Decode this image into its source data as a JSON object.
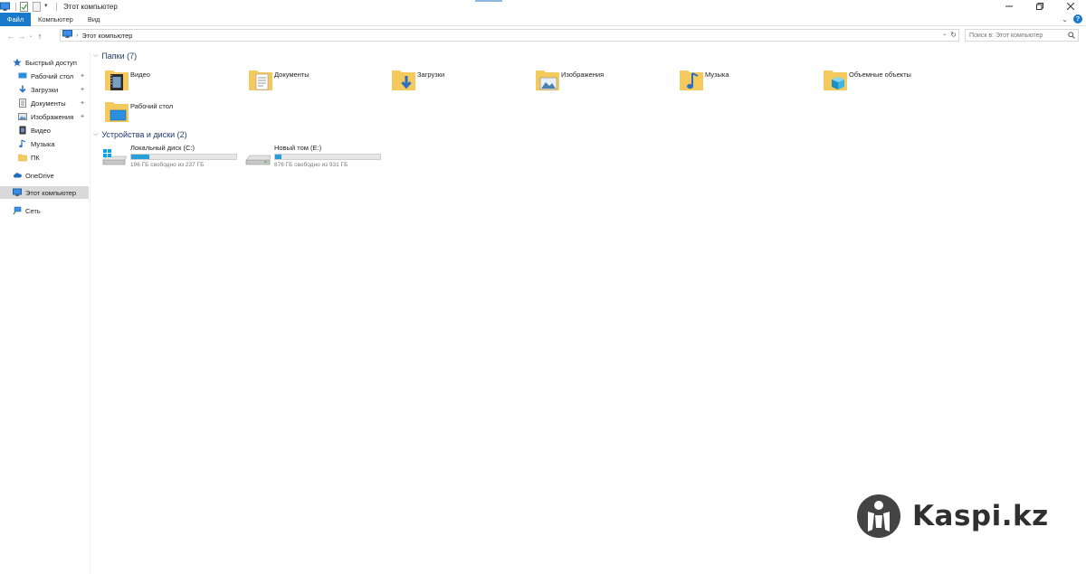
{
  "window": {
    "title": "Этот компьютер",
    "controls": [
      "minimize",
      "restore",
      "close"
    ]
  },
  "ribbon": {
    "tabs": [
      {
        "label": "Файл",
        "active": true
      },
      {
        "label": "Компьютер"
      },
      {
        "label": "Вид"
      }
    ]
  },
  "navigation": {
    "address": "Этот компьютер",
    "search_placeholder": "Поиск в: Этот компьютер"
  },
  "sidebar": {
    "items": [
      {
        "label": "Быстрый доступ",
        "icon": "star-icon"
      },
      {
        "label": "Рабочий стол",
        "icon": "desktop-icon",
        "pinned": true
      },
      {
        "label": "Загрузки",
        "icon": "download-icon",
        "pinned": true
      },
      {
        "label": "Документы",
        "icon": "document-icon",
        "pinned": true
      },
      {
        "label": "Изображения",
        "icon": "image-icon",
        "pinned": true
      },
      {
        "label": "Видео",
        "icon": "video-icon"
      },
      {
        "label": "Музыка",
        "icon": "music-icon"
      },
      {
        "label": "ПК",
        "icon": "folder-icon"
      },
      {
        "label": "OneDrive",
        "icon": "cloud-icon"
      },
      {
        "label": "Этот компьютер",
        "icon": "computer-icon",
        "selected": true
      },
      {
        "label": "Сеть",
        "icon": "network-icon"
      }
    ]
  },
  "folders": {
    "header": "Папки (7)",
    "items": [
      {
        "label": "Видео",
        "icon": "video-folder-icon"
      },
      {
        "label": "Документы",
        "icon": "documents-folder-icon"
      },
      {
        "label": "Загрузки",
        "icon": "downloads-folder-icon"
      },
      {
        "label": "Изображения",
        "icon": "pictures-folder-icon"
      },
      {
        "label": "Музыка",
        "icon": "music-folder-icon"
      },
      {
        "label": "Объемные объекты",
        "icon": "3d-objects-folder-icon"
      },
      {
        "label": "Рабочий стол",
        "icon": "desktop-folder-icon"
      }
    ]
  },
  "drives": {
    "header": "Устройства и диски (2)",
    "items": [
      {
        "label": "Локальный диск (C:)",
        "free": "196 ГБ свободно из 237 ГБ",
        "used_fraction": 0.173
      },
      {
        "label": "Новый том (E:)",
        "free": "876 ГБ свободно из 931 ГБ",
        "used_fraction": 0.059
      }
    ]
  },
  "watermark": {
    "text": "Kaspi.kz"
  },
  "colors": {
    "accent": "#1979ca",
    "drive_bar": "#26a0da",
    "folder": "#f4c95d"
  }
}
